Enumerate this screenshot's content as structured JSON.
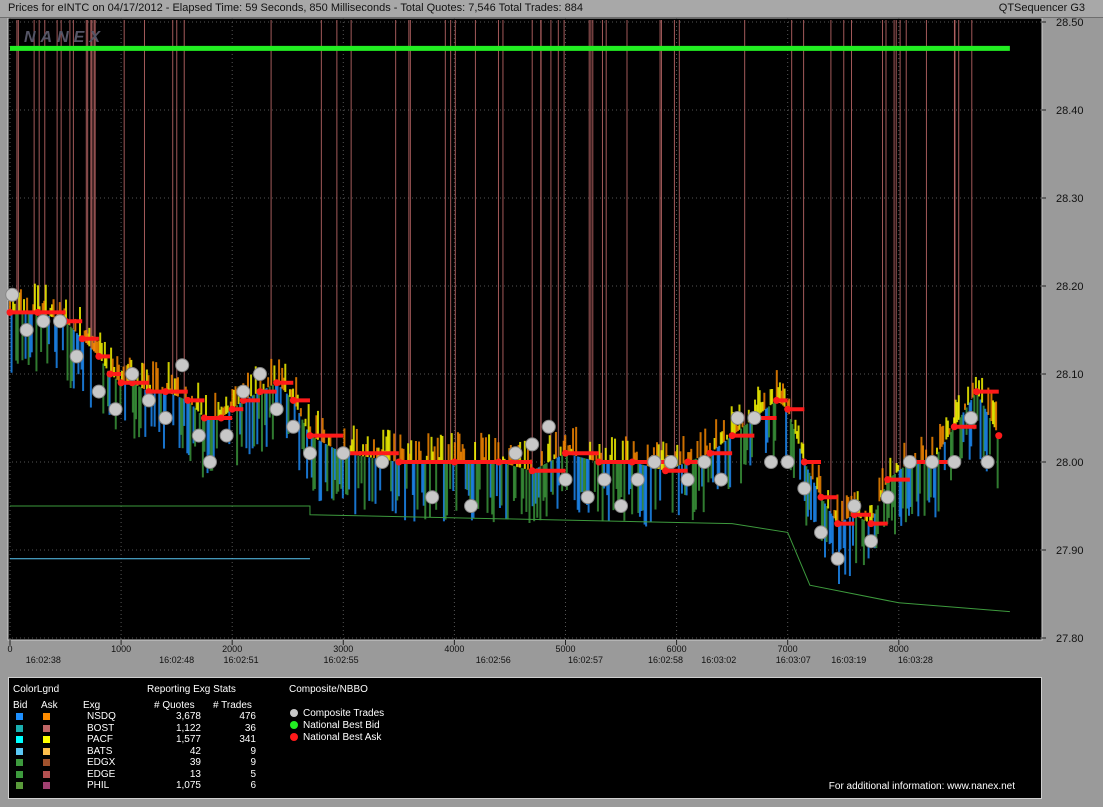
{
  "header": {
    "title": "Prices for  eINTC  on  04/17/2012  -  Elapsed Time: 59 Seconds, 850 Milliseconds  -  Total Quotes: 7,546  Total Trades: 884",
    "app_name": "QTSequencer G3",
    "watermark": "NANEX"
  },
  "chart_data": {
    "type": "line",
    "title": "Prices for eINTC on 04/17/2012",
    "xlim": [
      0,
      9000
    ],
    "ylim": [
      27.8,
      28.5
    ],
    "x_ticks": [
      0,
      1000,
      2000,
      3000,
      4000,
      5000,
      6000,
      7000,
      8000
    ],
    "y_ticks": [
      27.8,
      27.9,
      28.0,
      28.1,
      28.2,
      28.3,
      28.4,
      28.5
    ],
    "y_tick_labels": [
      "27.80",
      "27.90",
      "28.00",
      "28.10",
      "28.20",
      "28.30",
      "28.40",
      "28.50"
    ],
    "time_labels": [
      {
        "x": 300,
        "label": "16:02:38"
      },
      {
        "x": 1500,
        "label": "16:02:48"
      },
      {
        "x": 2080,
        "label": "16:02:51"
      },
      {
        "x": 2980,
        "label": "16:02:55"
      },
      {
        "x": 4350,
        "label": "16:02:56"
      },
      {
        "x": 5180,
        "label": "16:02:57"
      },
      {
        "x": 5900,
        "label": "16:02:58"
      },
      {
        "x": 6380,
        "label": "16:03:02"
      },
      {
        "x": 7050,
        "label": "16:03:07"
      },
      {
        "x": 7550,
        "label": "16:03:19"
      },
      {
        "x": 8150,
        "label": "16:03:28"
      }
    ],
    "series": [
      {
        "name": "National Best Bid",
        "color": "#22ee22",
        "x": [
          0,
          6950,
          7080,
          9000
        ],
        "y": [
          28.47,
          28.47,
          28.47,
          28.47
        ]
      },
      {
        "name": "National Best Ask",
        "color": "#ff1a1a",
        "x": [
          0,
          250,
          500,
          650,
          800,
          900,
          1000,
          1100,
          1250,
          1400,
          1600,
          1750,
          1900,
          2000,
          2100,
          2250,
          2400,
          2550,
          2700,
          3000,
          3500,
          4000,
          4400,
          4700,
          5000,
          5300,
          5600,
          5900,
          6100,
          6300,
          6500,
          6700,
          6900,
          7000,
          7150,
          7300,
          7450,
          7600,
          7750,
          7900,
          8100,
          8300,
          8500,
          8700,
          8900
        ],
        "y": [
          28.17,
          28.17,
          28.16,
          28.14,
          28.12,
          28.1,
          28.09,
          28.09,
          28.08,
          28.08,
          28.07,
          28.05,
          28.05,
          28.06,
          28.07,
          28.08,
          28.09,
          28.07,
          28.03,
          28.01,
          28.0,
          28.0,
          28.0,
          27.99,
          28.01,
          28.0,
          28.0,
          27.99,
          28.0,
          28.01,
          28.03,
          28.05,
          28.07,
          28.06,
          28.0,
          27.96,
          27.93,
          27.94,
          27.93,
          27.98,
          28.0,
          28.0,
          28.04,
          28.08,
          28.03
        ]
      },
      {
        "name": "Composite Trades",
        "color": "#c8c8c8",
        "x": [
          20,
          150,
          300,
          450,
          600,
          800,
          950,
          1100,
          1250,
          1400,
          1550,
          1700,
          1800,
          1950,
          2100,
          2250,
          2400,
          2550,
          2700,
          3000,
          3350,
          3800,
          4150,
          4550,
          4700,
          4850,
          5000,
          5200,
          5350,
          5500,
          5650,
          5800,
          5950,
          6100,
          6250,
          6400,
          6550,
          6700,
          6850,
          7000,
          7150,
          7300,
          7450,
          7600,
          7750,
          7900,
          8100,
          8300,
          8500,
          8650,
          8800
        ],
        "y": [
          28.19,
          28.15,
          28.16,
          28.16,
          28.12,
          28.08,
          28.06,
          28.1,
          28.07,
          28.05,
          28.11,
          28.03,
          28.0,
          28.03,
          28.08,
          28.1,
          28.06,
          28.04,
          28.01,
          28.01,
          28.0,
          27.96,
          27.95,
          28.01,
          28.02,
          28.04,
          27.98,
          27.96,
          27.98,
          27.95,
          27.98,
          28.0,
          28.0,
          27.98,
          28.0,
          27.98,
          28.05,
          28.05,
          28.0,
          28.0,
          27.97,
          27.92,
          27.89,
          27.95,
          27.91,
          27.96,
          28.0,
          28.0,
          28.0,
          28.05,
          28.0
        ]
      }
    ],
    "legend_placement": "bottom-left",
    "grid": true
  },
  "legend": {
    "header_colorlgnd": "ColorLgnd",
    "header_bid": "Bid",
    "header_ask": "Ask",
    "header_exg": "Exg",
    "header_stats": "Reporting Exg Stats",
    "header_quotes": "# Quotes",
    "header_trades": "# Trades",
    "header_composite": "Composite/NBBO",
    "exchanges": [
      {
        "name": "NSDQ",
        "quotes": "3,678",
        "trades": "476",
        "bid_color": "#1e90ff",
        "ask_color": "#ff8c00"
      },
      {
        "name": "BOST",
        "quotes": "1,122",
        "trades": "36",
        "bid_color": "#1ab0b0",
        "ask_color": "#c06666"
      },
      {
        "name": "PACF",
        "quotes": "1,577",
        "trades": "341",
        "bid_color": "#00ffff",
        "ask_color": "#ffff00"
      },
      {
        "name": "BATS",
        "quotes": "42",
        "trades": "9",
        "bid_color": "#5bc8f5",
        "ask_color": "#ffc04d"
      },
      {
        "name": "EDGX",
        "quotes": "39",
        "trades": "9",
        "bid_color": "#3d9a3d",
        "ask_color": "#a0522d"
      },
      {
        "name": "EDGE",
        "quotes": "13",
        "trades": "5",
        "bid_color": "#3d9a3d",
        "ask_color": "#b35050"
      },
      {
        "name": "PHIL",
        "quotes": "1,075",
        "trades": "6",
        "bid_color": "#5a9a3a",
        "ask_color": "#a04070"
      }
    ],
    "composite": [
      {
        "label": "Composite Trades",
        "color": "#c8c8c8"
      },
      {
        "label": "National Best Bid",
        "color": "#22ee22"
      },
      {
        "label": "National Best Ask",
        "color": "#ff1a1a"
      }
    ],
    "info": "For additional information: www.nanex.net"
  }
}
